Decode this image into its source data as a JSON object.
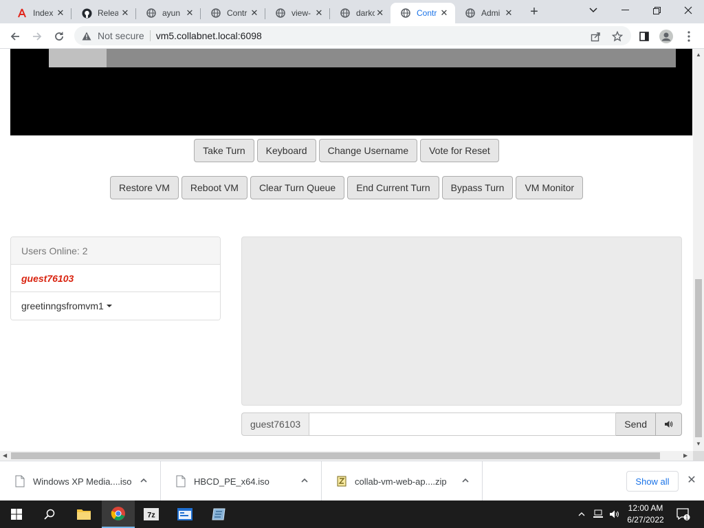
{
  "browser": {
    "tabs": [
      {
        "title": "Index",
        "icon": "acrobat-icon"
      },
      {
        "title": "Relea",
        "icon": "github-icon"
      },
      {
        "title": "ayun",
        "icon": "globe-icon"
      },
      {
        "title": "Contr",
        "icon": "globe-icon"
      },
      {
        "title": "view-",
        "icon": "globe-icon"
      },
      {
        "title": "darkc",
        "icon": "globe-icon"
      },
      {
        "title": "Contr",
        "icon": "globe-icon",
        "active": true
      },
      {
        "title": "Admi",
        "icon": "globe-icon"
      }
    ],
    "security_label": "Not secure",
    "url": "vm5.collabnet.local:6098"
  },
  "vm_controls": {
    "row1": [
      "Take Turn",
      "Keyboard",
      "Change Username",
      "Vote for Reset"
    ],
    "row2": [
      "Restore VM",
      "Reboot VM",
      "Clear Turn Queue",
      "End Current Turn",
      "Bypass Turn",
      "VM Monitor"
    ]
  },
  "users_panel": {
    "header": "Users Online: 2",
    "users": [
      "guest76103",
      "greetinngsfromvm1"
    ]
  },
  "chat": {
    "username": "guest76103",
    "input_value": "",
    "send_label": "Send",
    "volume_icon": "speaker-icon"
  },
  "downloads": {
    "items": [
      "Windows XP Media....iso",
      "HBCD_PE_x64.iso",
      "collab-vm-web-ap....zip"
    ],
    "show_all_label": "Show all"
  },
  "taskbar": {
    "time": "12:00 AM",
    "date": "6/27/2022",
    "notification_count": "1",
    "colors": {
      "taskbar_bg": "#1c1c1c",
      "accent": "#1a73e8",
      "self_user": "#d9230f"
    }
  }
}
